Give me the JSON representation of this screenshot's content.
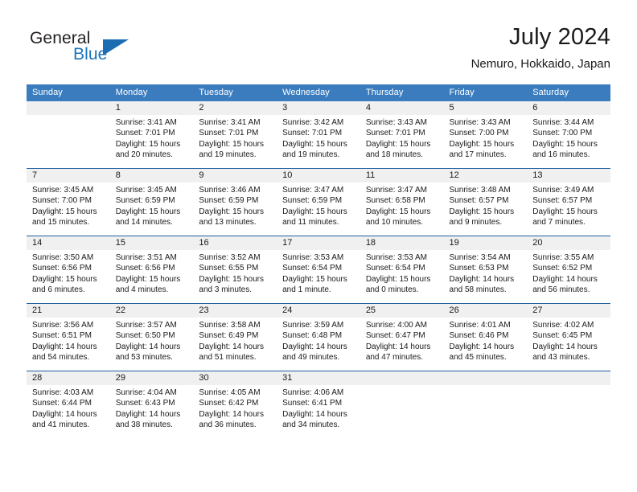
{
  "brand": {
    "name_top": "General",
    "name_bottom": "Blue",
    "triangle_icon": "triangle-icon",
    "accent_color": "#1b75bb"
  },
  "header": {
    "title": "July 2024",
    "subtitle": "Nemuro, Hokkaido, Japan"
  },
  "calendar": {
    "header_bg": "#3a7cbe",
    "daynum_bg": "#f0f0f0",
    "separator_color": "#1f5fa0",
    "weekday_headers": [
      "Sunday",
      "Monday",
      "Tuesday",
      "Wednesday",
      "Thursday",
      "Friday",
      "Saturday"
    ],
    "weeks": [
      [
        {
          "day": "",
          "lines": []
        },
        {
          "day": "1",
          "lines": [
            "Sunrise: 3:41 AM",
            "Sunset: 7:01 PM",
            "Daylight: 15 hours",
            "and 20 minutes."
          ]
        },
        {
          "day": "2",
          "lines": [
            "Sunrise: 3:41 AM",
            "Sunset: 7:01 PM",
            "Daylight: 15 hours",
            "and 19 minutes."
          ]
        },
        {
          "day": "3",
          "lines": [
            "Sunrise: 3:42 AM",
            "Sunset: 7:01 PM",
            "Daylight: 15 hours",
            "and 19 minutes."
          ]
        },
        {
          "day": "4",
          "lines": [
            "Sunrise: 3:43 AM",
            "Sunset: 7:01 PM",
            "Daylight: 15 hours",
            "and 18 minutes."
          ]
        },
        {
          "day": "5",
          "lines": [
            "Sunrise: 3:43 AM",
            "Sunset: 7:00 PM",
            "Daylight: 15 hours",
            "and 17 minutes."
          ]
        },
        {
          "day": "6",
          "lines": [
            "Sunrise: 3:44 AM",
            "Sunset: 7:00 PM",
            "Daylight: 15 hours",
            "and 16 minutes."
          ]
        }
      ],
      [
        {
          "day": "7",
          "lines": [
            "Sunrise: 3:45 AM",
            "Sunset: 7:00 PM",
            "Daylight: 15 hours",
            "and 15 minutes."
          ]
        },
        {
          "day": "8",
          "lines": [
            "Sunrise: 3:45 AM",
            "Sunset: 6:59 PM",
            "Daylight: 15 hours",
            "and 14 minutes."
          ]
        },
        {
          "day": "9",
          "lines": [
            "Sunrise: 3:46 AM",
            "Sunset: 6:59 PM",
            "Daylight: 15 hours",
            "and 13 minutes."
          ]
        },
        {
          "day": "10",
          "lines": [
            "Sunrise: 3:47 AM",
            "Sunset: 6:59 PM",
            "Daylight: 15 hours",
            "and 11 minutes."
          ]
        },
        {
          "day": "11",
          "lines": [
            "Sunrise: 3:47 AM",
            "Sunset: 6:58 PM",
            "Daylight: 15 hours",
            "and 10 minutes."
          ]
        },
        {
          "day": "12",
          "lines": [
            "Sunrise: 3:48 AM",
            "Sunset: 6:57 PM",
            "Daylight: 15 hours",
            "and 9 minutes."
          ]
        },
        {
          "day": "13",
          "lines": [
            "Sunrise: 3:49 AM",
            "Sunset: 6:57 PM",
            "Daylight: 15 hours",
            "and 7 minutes."
          ]
        }
      ],
      [
        {
          "day": "14",
          "lines": [
            "Sunrise: 3:50 AM",
            "Sunset: 6:56 PM",
            "Daylight: 15 hours",
            "and 6 minutes."
          ]
        },
        {
          "day": "15",
          "lines": [
            "Sunrise: 3:51 AM",
            "Sunset: 6:56 PM",
            "Daylight: 15 hours",
            "and 4 minutes."
          ]
        },
        {
          "day": "16",
          "lines": [
            "Sunrise: 3:52 AM",
            "Sunset: 6:55 PM",
            "Daylight: 15 hours",
            "and 3 minutes."
          ]
        },
        {
          "day": "17",
          "lines": [
            "Sunrise: 3:53 AM",
            "Sunset: 6:54 PM",
            "Daylight: 15 hours",
            "and 1 minute."
          ]
        },
        {
          "day": "18",
          "lines": [
            "Sunrise: 3:53 AM",
            "Sunset: 6:54 PM",
            "Daylight: 15 hours",
            "and 0 minutes."
          ]
        },
        {
          "day": "19",
          "lines": [
            "Sunrise: 3:54 AM",
            "Sunset: 6:53 PM",
            "Daylight: 14 hours",
            "and 58 minutes."
          ]
        },
        {
          "day": "20",
          "lines": [
            "Sunrise: 3:55 AM",
            "Sunset: 6:52 PM",
            "Daylight: 14 hours",
            "and 56 minutes."
          ]
        }
      ],
      [
        {
          "day": "21",
          "lines": [
            "Sunrise: 3:56 AM",
            "Sunset: 6:51 PM",
            "Daylight: 14 hours",
            "and 54 minutes."
          ]
        },
        {
          "day": "22",
          "lines": [
            "Sunrise: 3:57 AM",
            "Sunset: 6:50 PM",
            "Daylight: 14 hours",
            "and 53 minutes."
          ]
        },
        {
          "day": "23",
          "lines": [
            "Sunrise: 3:58 AM",
            "Sunset: 6:49 PM",
            "Daylight: 14 hours",
            "and 51 minutes."
          ]
        },
        {
          "day": "24",
          "lines": [
            "Sunrise: 3:59 AM",
            "Sunset: 6:48 PM",
            "Daylight: 14 hours",
            "and 49 minutes."
          ]
        },
        {
          "day": "25",
          "lines": [
            "Sunrise: 4:00 AM",
            "Sunset: 6:47 PM",
            "Daylight: 14 hours",
            "and 47 minutes."
          ]
        },
        {
          "day": "26",
          "lines": [
            "Sunrise: 4:01 AM",
            "Sunset: 6:46 PM",
            "Daylight: 14 hours",
            "and 45 minutes."
          ]
        },
        {
          "day": "27",
          "lines": [
            "Sunrise: 4:02 AM",
            "Sunset: 6:45 PM",
            "Daylight: 14 hours",
            "and 43 minutes."
          ]
        }
      ],
      [
        {
          "day": "28",
          "lines": [
            "Sunrise: 4:03 AM",
            "Sunset: 6:44 PM",
            "Daylight: 14 hours",
            "and 41 minutes."
          ]
        },
        {
          "day": "29",
          "lines": [
            "Sunrise: 4:04 AM",
            "Sunset: 6:43 PM",
            "Daylight: 14 hours",
            "and 38 minutes."
          ]
        },
        {
          "day": "30",
          "lines": [
            "Sunrise: 4:05 AM",
            "Sunset: 6:42 PM",
            "Daylight: 14 hours",
            "and 36 minutes."
          ]
        },
        {
          "day": "31",
          "lines": [
            "Sunrise: 4:06 AM",
            "Sunset: 6:41 PM",
            "Daylight: 14 hours",
            "and 34 minutes."
          ]
        },
        {
          "day": "",
          "lines": []
        },
        {
          "day": "",
          "lines": []
        },
        {
          "day": "",
          "lines": []
        }
      ]
    ]
  }
}
